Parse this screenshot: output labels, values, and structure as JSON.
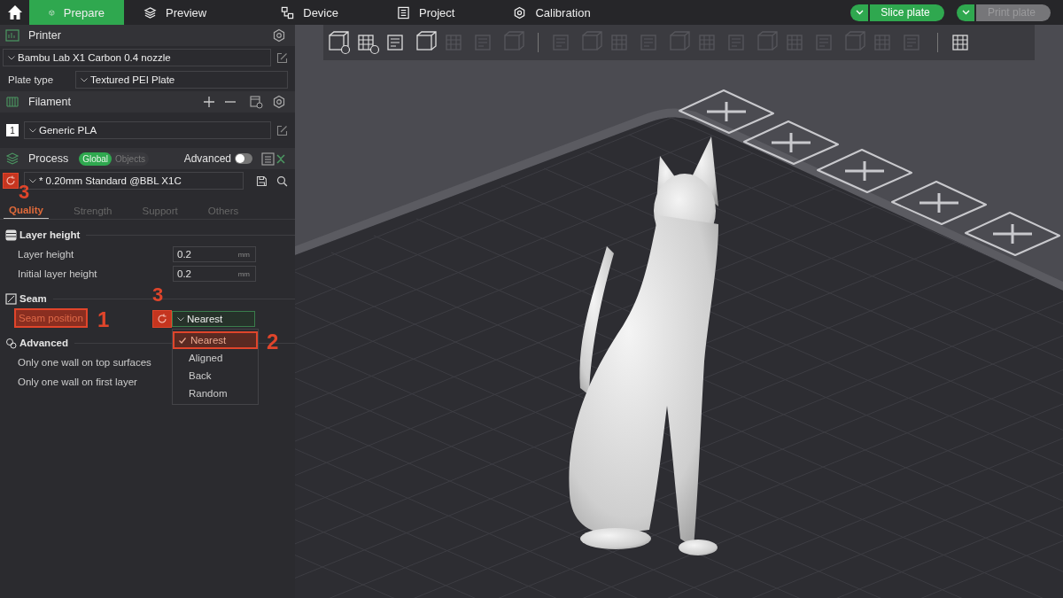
{
  "top_bar": {
    "tabs": [
      {
        "label": "Prepare",
        "selected": true
      },
      {
        "label": "Preview",
        "selected": false
      },
      {
        "label": "Device",
        "selected": false
      },
      {
        "label": "Project",
        "selected": false
      },
      {
        "label": "Calibration",
        "selected": false
      }
    ],
    "slice_button": {
      "label": "Slice plate",
      "disabled": false
    },
    "print_button": {
      "label": "Print plate",
      "disabled": true
    }
  },
  "printer": {
    "title": "Printer",
    "preset": "Bambu Lab X1 Carbon 0.4 nozzle",
    "plate_type_label": "Plate type",
    "plate_type": "Textured PEI Plate"
  },
  "filament": {
    "title": "Filament",
    "slots": [
      {
        "number": "1",
        "name": "Generic PLA"
      }
    ]
  },
  "process": {
    "title": "Process",
    "scope": [
      {
        "label": "Global",
        "selected": true
      },
      {
        "label": "Objects",
        "selected": false
      }
    ],
    "advanced_label": "Advanced",
    "advanced_on": false,
    "preset": "* 0.20mm Standard @BBL X1C",
    "preset_annotation": "3",
    "tabs": [
      {
        "label": "Quality",
        "selected": true
      },
      {
        "label": "Strength",
        "selected": false
      },
      {
        "label": "Support",
        "selected": false
      },
      {
        "label": "Others",
        "selected": false
      }
    ]
  },
  "sections": [
    {
      "title": "Layer height",
      "settings": [
        {
          "kind": "number",
          "label": "Layer height",
          "value": "0.2",
          "unit": "mm"
        },
        {
          "kind": "number",
          "label": "Initial layer height",
          "value": "0.2",
          "unit": "mm"
        }
      ]
    },
    {
      "title": "Seam",
      "settings": [
        {
          "kind": "dropdown",
          "label": "Seam position",
          "label_annotation": "1",
          "reset_annotation": "3",
          "value": "Nearest",
          "expanded": true,
          "options_annotation": "2",
          "options": [
            {
              "label": "Nearest",
              "selected": true
            },
            {
              "label": "Aligned",
              "selected": false
            },
            {
              "label": "Back",
              "selected": false
            },
            {
              "label": "Random",
              "selected": false
            }
          ]
        }
      ]
    },
    {
      "title": "Advanced",
      "settings": [
        {
          "kind": "hidden",
          "label": "Only one wall on top surfaces"
        },
        {
          "kind": "hidden",
          "label": "Only one wall on first layer"
        }
      ]
    }
  ]
}
